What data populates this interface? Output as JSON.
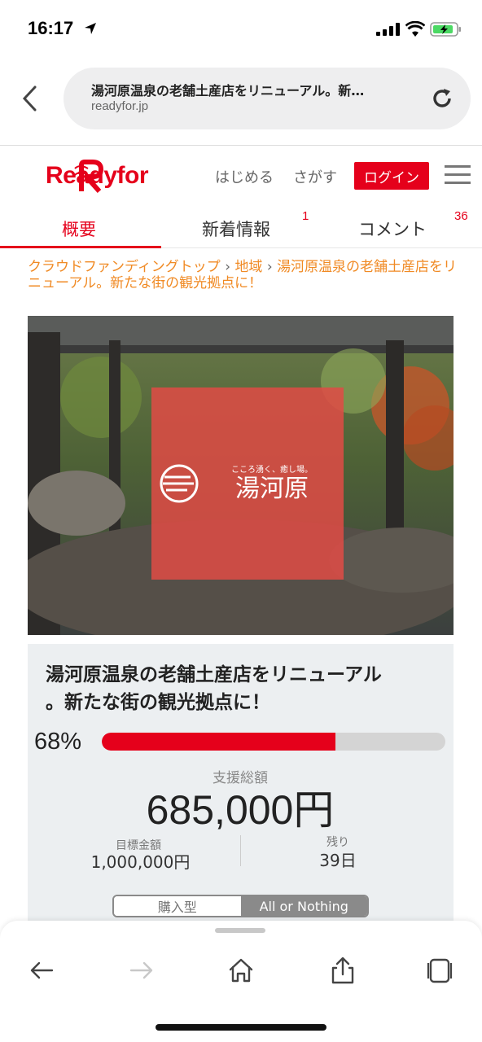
{
  "status": {
    "time": "16:17"
  },
  "browser": {
    "page_title": "湯河原温泉の老舗土産店をリニューアル。新…",
    "host": "readyfor.jp"
  },
  "site": {
    "logo_text": "Readyfor",
    "nav_start": "はじめる",
    "nav_search": "さがす",
    "login": "ログイン"
  },
  "tabs": [
    {
      "label": "概要",
      "badge": ""
    },
    {
      "label": "新着情報",
      "badge": "1"
    },
    {
      "label": "コメント",
      "badge": "36"
    }
  ],
  "breadcrumb": {
    "top": "クラウドファンディングトップ",
    "sep": "›",
    "region": "地域",
    "current": "湯河原温泉の老舗土産店をリニューアル。新たな街の観光拠点に！"
  },
  "hero": {
    "tagline": "こころ湧く、癒し場。",
    "town": "湯河原"
  },
  "project": {
    "title_line1": "湯河原温泉の老舗土産店をリニューアル",
    "title_line2": "。新たな街の観光拠点に！",
    "progress_label": "68%",
    "progress": 0.68,
    "raised_label": "支援総額",
    "raised": "685,000円",
    "goal_label": "目標金額",
    "goal": "1,000,000円",
    "remaining_label": "残り",
    "remaining": "39日",
    "type_purchase": "購入型",
    "type_aon": "All or Nothing"
  },
  "colors": {
    "brand": "#e5001b",
    "crumb": "#f08a24"
  }
}
